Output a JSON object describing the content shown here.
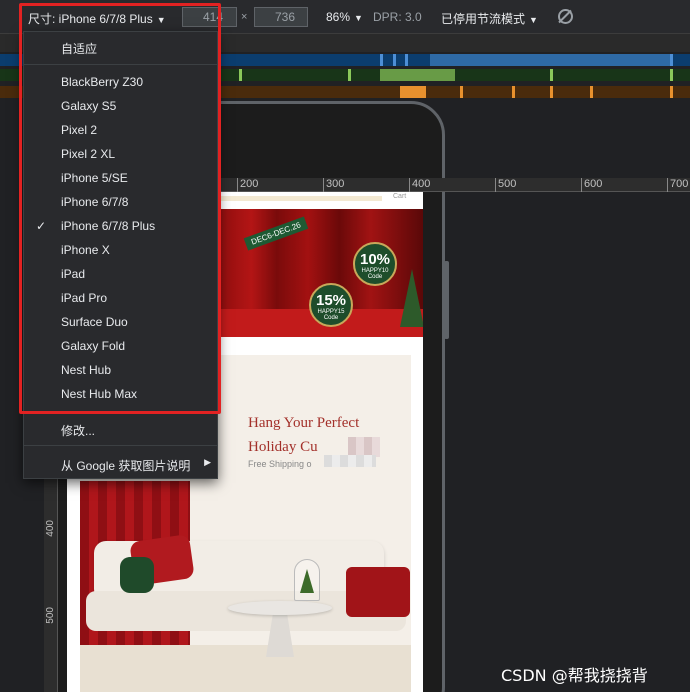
{
  "toolbar": {
    "device_label": "尺寸: iPhone 6/7/8 Plus",
    "width_value": "414",
    "height_value": "736",
    "times": "×",
    "zoom": "86%",
    "dpr": "DPR: 3.0",
    "throttle": "已停用节流模式",
    "caret": "▼"
  },
  "rulers": {
    "top_labels": [
      "200",
      "300",
      "400",
      "500",
      "600",
      "700"
    ],
    "left_labels": [
      "400",
      "500"
    ]
  },
  "page": {
    "cart": "Cart",
    "banner": {
      "date_tag": "DEC6-DEC.26",
      "badge1_amount": "10%",
      "badge1_code": "HAPPY10 Code",
      "badge2_amount": "15%",
      "badge2_code": "HAPPY15 Code"
    },
    "product": {
      "title_line1": "Hang Your Perfect",
      "title_line2": "Holiday Cu",
      "subtitle": "Free Shipping o"
    }
  },
  "menu": {
    "items_top": [
      "自适应"
    ],
    "devices": [
      "BlackBerry Z30",
      "Galaxy S5",
      "Pixel 2",
      "Pixel 2 XL",
      "iPhone 5/SE",
      "iPhone 6/7/8",
      "iPhone 6/7/8 Plus",
      "iPhone X",
      "iPad",
      "iPad Pro",
      "Surface Duo",
      "Galaxy Fold",
      "Nest Hub",
      "Nest Hub Max"
    ],
    "selected_index": 6,
    "check": "✓",
    "edit": "修改...",
    "google": "从 Google 获取图片说明",
    "submenu_arrow": "▶"
  },
  "watermark": "CSDN @帮我挠挠背",
  "colors": {
    "highlight_box": "#e22222",
    "product_title": "#a3302a"
  }
}
